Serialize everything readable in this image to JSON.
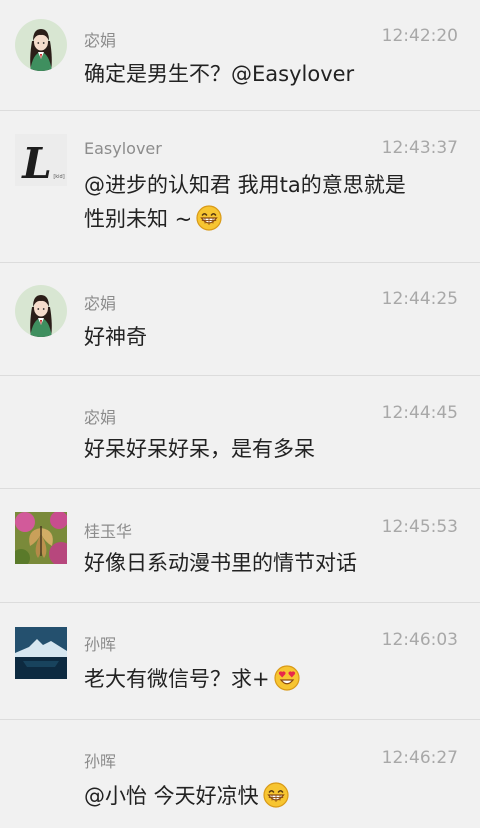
{
  "messages": [
    {
      "user": "宓娟",
      "time": "12:42:20",
      "text": "确定是男生不？@Easylover",
      "avatar": "girl-avatar"
    },
    {
      "user": "Easylover",
      "time": "12:43:37",
      "line1": "@进步的认知君 我用ta的意思就是",
      "line2": "性别未知 ~",
      "avatar": "letter-l-avatar",
      "emoji": "grinning-face-emoji"
    },
    {
      "user": "宓娟",
      "time": "12:44:25",
      "text": "好神奇",
      "avatar": "girl-avatar"
    },
    {
      "user": "宓娟",
      "time": "12:44:45",
      "text": "好呆好呆好呆，是有多呆"
    },
    {
      "user": "桂玉华",
      "time": "12:45:53",
      "text": "好像日系动漫书里的情节对话",
      "avatar": "butterfly-avatar"
    },
    {
      "user": "孙晖",
      "time": "12:46:03",
      "text": "老大有微信号？求+",
      "avatar": "iceberg-avatar",
      "emoji": "heart-eyes-emoji"
    },
    {
      "user": "孙晖",
      "time": "12:46:27",
      "text": "@小怡 今天好凉快",
      "emoji": "grinning-face-emoji"
    }
  ],
  "colors": {
    "background": "#f1f1f1",
    "divider": "#dcdcdc",
    "name": "#8c8c8c",
    "time": "#a8a8a8",
    "text": "#222222"
  }
}
